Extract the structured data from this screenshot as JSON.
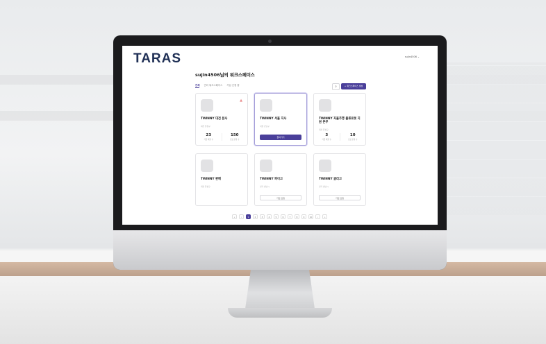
{
  "app": {
    "logo_text": "TARAS",
    "user_menu": "sujin4506 ⌄"
  },
  "workspace": {
    "title": "sujin4506님의 워크스페이스"
  },
  "tabs": [
    {
      "label": "전체"
    },
    {
      "label": "관리 워크스페이스"
    },
    {
      "label": "가입 신청 중"
    }
  ],
  "toolbar": {
    "search_icon": "⌕",
    "create_label": "+ 워크스페이스 생성"
  },
  "cards": [
    {
      "name": "TWINNY 대전 본사",
      "sub": "대전 유성구",
      "stat1_value": "23",
      "stat1_label": "가입 회원 수",
      "stat2_value": "150",
      "stat2_label": "로봇 운행 수"
    },
    {
      "name": "TWINNY 서울 지사",
      "sub": "서울 강남구",
      "button": "들어가기"
    },
    {
      "name": "TWINNY 자율주행 물류로봇 지원 본부",
      "sub": "대전 유성구",
      "stat1_value": "3",
      "stat1_label": "가입 회원 수",
      "stat2_value": "10",
      "stat2_label": "로봇 운행 수"
    },
    {
      "name": "TWINNY 판매",
      "sub": "대전 유성구"
    },
    {
      "name": "TWINNY 파이고",
      "sub": "경기 성남시",
      "button": "가입 요청"
    },
    {
      "name": "TWINNY 글리고",
      "sub": "경기 성남시",
      "button": "가입 요청"
    }
  ],
  "pagination": {
    "prev_first": "«",
    "prev": "‹",
    "pages": [
      "1",
      "2",
      "3",
      "4",
      "5",
      "6",
      "7",
      "8",
      "9",
      "10"
    ],
    "next": "›",
    "next_last": "»",
    "current": "1"
  }
}
